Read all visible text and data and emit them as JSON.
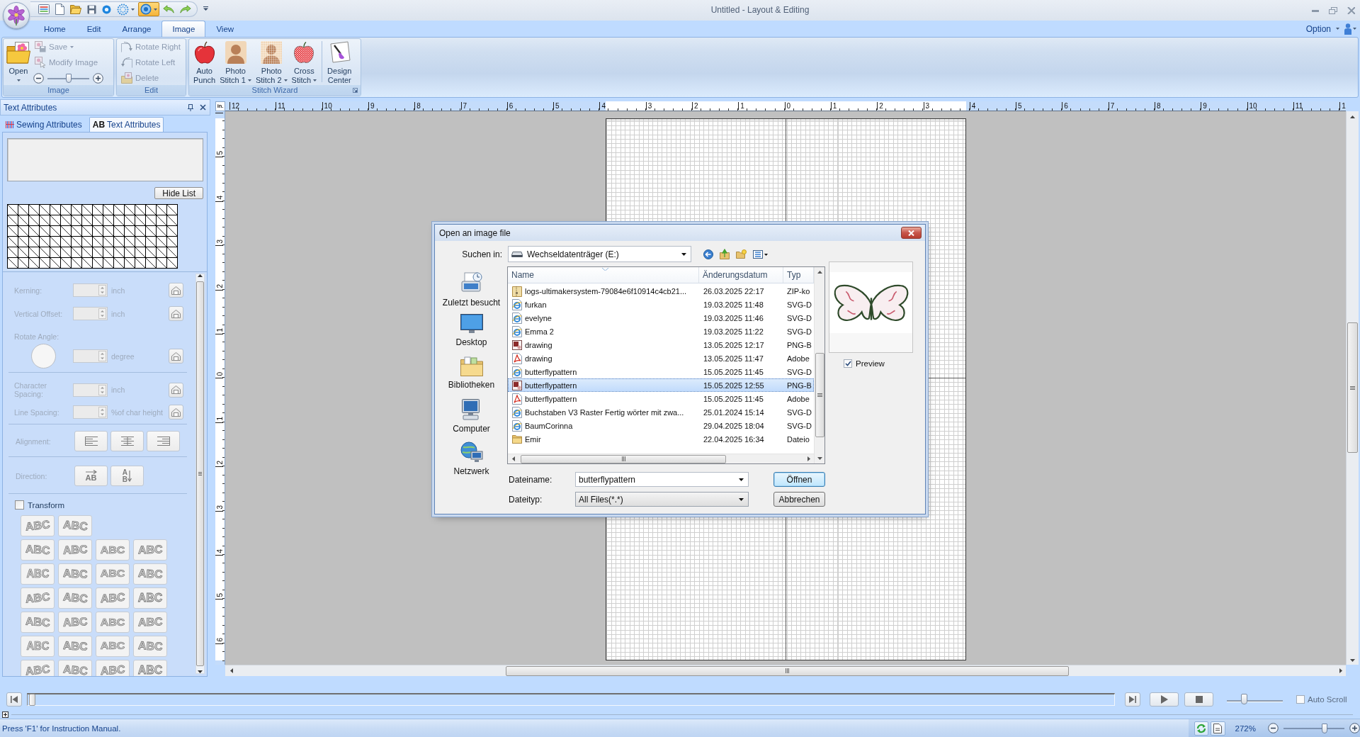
{
  "window": {
    "title": "Untitled - Layout & Editing"
  },
  "quick_access": [
    {
      "kind": "window",
      "on": false,
      "dropdown": false
    },
    {
      "kind": "new",
      "on": false,
      "dropdown": false
    },
    {
      "kind": "open",
      "on": false,
      "dropdown": false
    },
    {
      "kind": "save",
      "on": false,
      "dropdown": false
    },
    {
      "kind": "dot",
      "on": false,
      "dropdown": false
    },
    {
      "kind": "burst",
      "on": false,
      "dropdown": true
    },
    {
      "kind": "ring",
      "on": true,
      "dropdown": true
    },
    {
      "kind": "undo",
      "on": false,
      "dropdown": false
    },
    {
      "kind": "redo",
      "on": false,
      "dropdown": false
    }
  ],
  "tabs": [
    {
      "label": "Home",
      "selected": false
    },
    {
      "label": "Edit",
      "selected": false
    },
    {
      "label": "Arrange",
      "selected": false
    },
    {
      "label": "Image",
      "selected": true
    },
    {
      "label": "View",
      "selected": false
    }
  ],
  "option_menu": {
    "label": "Option"
  },
  "ribbon": {
    "image_group": {
      "label": "Image",
      "open_button": {
        "label": "Open"
      },
      "actions": [
        {
          "kind": "save",
          "label": "Save",
          "disabled": true,
          "dropdown": true
        },
        {
          "kind": "modify",
          "label": "Modify Image",
          "disabled": true,
          "dropdown": false
        }
      ],
      "zoom": {
        "level": 0.5
      }
    },
    "edit_group": {
      "label": "Edit",
      "actions": [
        {
          "kind": "rotate-right",
          "label": "Rotate Right",
          "disabled": true
        },
        {
          "kind": "rotate-left",
          "label": "Rotate Left",
          "disabled": true
        },
        {
          "kind": "delete",
          "label": "Delete",
          "disabled": true
        }
      ]
    },
    "stitch_group": {
      "label": "Stitch Wizard",
      "buttons": [
        {
          "kind": "apple",
          "lines": [
            "Auto",
            "Punch"
          ],
          "dropdown": false,
          "separated": false
        },
        {
          "kind": "portrait",
          "lines": [
            "Photo",
            "Stitch 1"
          ],
          "dropdown": true,
          "separated": false
        },
        {
          "kind": "pixel-portrait",
          "lines": [
            "Photo",
            "Stitch 2"
          ],
          "dropdown": true,
          "separated": false
        },
        {
          "kind": "cross-stitch",
          "lines": [
            "Cross",
            "Stitch"
          ],
          "dropdown": true,
          "separated": false
        },
        {
          "kind": "brush",
          "lines": [
            "Design",
            "Center"
          ],
          "dropdown": false,
          "separated": true
        }
      ]
    }
  },
  "panel": {
    "title": "Text Attributes",
    "tabs": [
      {
        "kind": "sewing",
        "label": "Sewing Attributes",
        "selected": false
      },
      {
        "kind": "text",
        "icon_text": "AB",
        "label": "Text Attributes",
        "selected": true
      }
    ],
    "hide_list_button": {
      "label": "Hide List"
    },
    "sections": [
      [
        {
          "kind": "spin",
          "label": "Kerning:",
          "unit": "inch",
          "disabled": true
        },
        {
          "kind": "spin",
          "label": "Vertical Offset:",
          "unit": "inch",
          "disabled": true
        },
        {
          "kind": "angle",
          "label": "Rotate Angle:",
          "unit": "degree",
          "disabled": true
        }
      ],
      [
        {
          "kind": "spin",
          "label": "Character Spacing:",
          "unit": "inch",
          "disabled": true
        },
        {
          "kind": "spin",
          "label": "Line Spacing:",
          "unit": "%of char height",
          "disabled": true
        }
      ],
      [
        {
          "kind": "alignment",
          "label": "Alignment:",
          "disabled": true,
          "options": [
            {
              "kind": "left"
            },
            {
              "kind": "center"
            },
            {
              "kind": "right"
            }
          ]
        }
      ],
      [
        {
          "kind": "direction",
          "label": "Direction:",
          "disabled": true,
          "options": [
            {
              "kind": "horizontal",
              "text": "AB"
            },
            {
              "kind": "vertical",
              "text": "AB"
            }
          ]
        }
      ]
    ],
    "transform": {
      "label": "Transform",
      "checked": false,
      "presets": [
        [
          "ABC",
          "ABC"
        ],
        [
          "ABC",
          "ABC",
          "ABC",
          "ABC"
        ],
        [
          "ABC",
          "ABC",
          "ABC",
          "ABC"
        ],
        [
          "ABC",
          "ABC",
          "ABC",
          "ABC"
        ],
        [
          "ABC",
          "ABC",
          "ABC",
          "ABC"
        ],
        [
          "ABC",
          "ABC",
          "ABC",
          "ABC"
        ],
        [
          "ABC",
          "ABC",
          "ABC",
          "ABC"
        ]
      ]
    }
  },
  "rulers": {
    "unit": "in.",
    "horizontal": [
      "12",
      "11",
      "10",
      "9",
      "8",
      "7",
      "6",
      "5",
      "4",
      "3",
      "2",
      "1",
      "0",
      "1",
      "2",
      "3",
      "4",
      "5",
      "6",
      "7",
      "8",
      "9",
      "10",
      "11",
      "1"
    ],
    "vertical": [
      "5",
      "4",
      "3",
      "2",
      "1",
      "0",
      "1",
      "2",
      "3",
      "4",
      "5",
      "6"
    ]
  },
  "dialog": {
    "title": "Open an image file",
    "look_in": {
      "label": "Suchen in:",
      "value": "Wechseldatenträger (E:)"
    },
    "places": [
      {
        "kind": "recent",
        "label": "Zuletzt besucht"
      },
      {
        "kind": "desktop",
        "label": "Desktop"
      },
      {
        "kind": "libraries",
        "label": "Bibliotheken"
      },
      {
        "kind": "computer",
        "label": "Computer"
      },
      {
        "kind": "network",
        "label": "Netzwerk"
      }
    ],
    "columns": [
      "Name",
      "Änderungsdatum",
      "Typ"
    ],
    "files": [
      {
        "kind": "zip",
        "name": "logs-ultimakersystem-79084e6f10914c4cb21...",
        "date": "26.03.2025 22:17",
        "type": "ZIP-ko",
        "selected": false
      },
      {
        "kind": "svg",
        "name": "furkan",
        "date": "19.03.2025 11:48",
        "type": "SVG-D",
        "selected": false
      },
      {
        "kind": "svg",
        "name": "evelyne",
        "date": "19.03.2025 11:46",
        "type": "SVG-D",
        "selected": false
      },
      {
        "kind": "svg",
        "name": "Emma 2",
        "date": "19.03.2025 11:22",
        "type": "SVG-D",
        "selected": false
      },
      {
        "kind": "png",
        "name": "drawing",
        "date": "13.05.2025 12:17",
        "type": "PNG-B",
        "selected": false
      },
      {
        "kind": "pdf",
        "name": "drawing",
        "date": "13.05.2025 11:47",
        "type": "Adobe",
        "selected": false
      },
      {
        "kind": "svg",
        "name": "butterflypattern",
        "date": "15.05.2025 11:45",
        "type": "SVG-D",
        "selected": false
      },
      {
        "kind": "png",
        "name": "butterflypattern",
        "date": "15.05.2025 12:55",
        "type": "PNG-B",
        "selected": true
      },
      {
        "kind": "pdf",
        "name": "butterflypattern",
        "date": "15.05.2025 11:45",
        "type": "Adobe",
        "selected": false
      },
      {
        "kind": "svg",
        "name": "Buchstaben V3 Raster Fertig wörter mit zwa...",
        "date": "25.01.2024 15:14",
        "type": "SVG-D",
        "selected": false
      },
      {
        "kind": "svg",
        "name": "BaumCorinna",
        "date": "29.04.2025 18:04",
        "type": "SVG-D",
        "selected": false
      },
      {
        "kind": "folder",
        "name": "Emir",
        "date": "22.04.2025 16:34",
        "type": "Dateio",
        "selected": false
      }
    ],
    "preview": {
      "label": "Preview",
      "checked": true
    },
    "file_name": {
      "label": "Dateiname:",
      "value": "butterflypattern"
    },
    "file_type": {
      "label": "Dateityp:",
      "value": "All Files(*.*)"
    },
    "buttons": [
      {
        "kind": "default",
        "label": "Öffnen"
      },
      {
        "kind": "normal",
        "label": "Abbrechen"
      }
    ]
  },
  "playback": {
    "timeline": {
      "level": 0
    },
    "speed": {
      "level": 0.3
    },
    "auto_scroll": {
      "label": "Auto Scroll",
      "checked": false
    }
  },
  "status_bar": {
    "message": "Press 'F1' for Instruction Manual.",
    "zoom_label": "272%",
    "zoom": {
      "level": 0.67
    }
  }
}
